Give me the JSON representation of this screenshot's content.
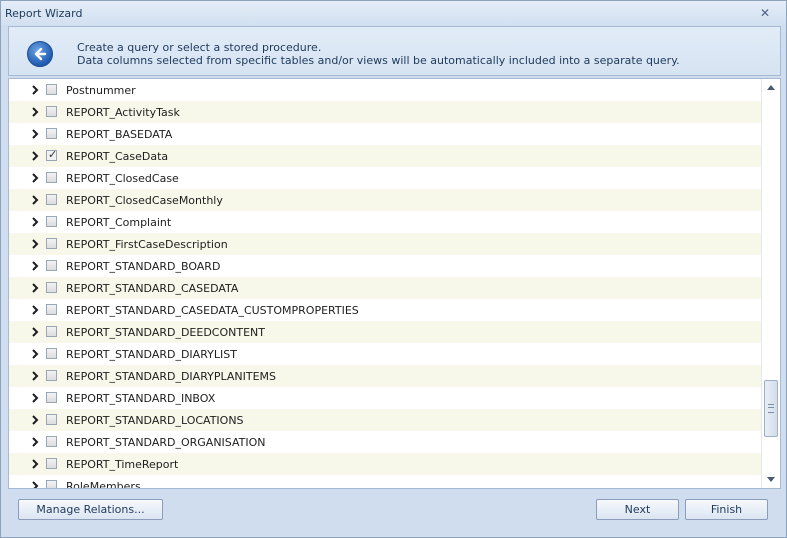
{
  "window": {
    "title": "Report Wizard"
  },
  "header": {
    "line1": "Create a query or select a stored procedure.",
    "line2": "Data columns selected from specific tables and/or views will be automatically included into a separate query."
  },
  "tables": [
    {
      "name": "Postnummer",
      "checked": false
    },
    {
      "name": "REPORT_ActivityTask",
      "checked": false
    },
    {
      "name": "REPORT_BASEDATA",
      "checked": false
    },
    {
      "name": "REPORT_CaseData",
      "checked": true
    },
    {
      "name": "REPORT_ClosedCase",
      "checked": false
    },
    {
      "name": "REPORT_ClosedCaseMonthly",
      "checked": false
    },
    {
      "name": "REPORT_Complaint",
      "checked": false
    },
    {
      "name": "REPORT_FirstCaseDescription",
      "checked": false
    },
    {
      "name": "REPORT_STANDARD_BOARD",
      "checked": false
    },
    {
      "name": "REPORT_STANDARD_CASEDATA",
      "checked": false
    },
    {
      "name": "REPORT_STANDARD_CASEDATA_CUSTOMPROPERTIES",
      "checked": false
    },
    {
      "name": "REPORT_STANDARD_DEEDCONTENT",
      "checked": false
    },
    {
      "name": "REPORT_STANDARD_DIARYLIST",
      "checked": false
    },
    {
      "name": "REPORT_STANDARD_DIARYPLANITEMS",
      "checked": false
    },
    {
      "name": "REPORT_STANDARD_INBOX",
      "checked": false
    },
    {
      "name": "REPORT_STANDARD_LOCATIONS",
      "checked": false
    },
    {
      "name": "REPORT_STANDARD_ORGANISATION",
      "checked": false
    },
    {
      "name": "REPORT_TimeReport",
      "checked": false
    },
    {
      "name": "RoleMembers",
      "checked": false
    }
  ],
  "buttons": {
    "manage_relations": "Manage Relations...",
    "next": "Next",
    "finish": "Finish"
  },
  "icons": {
    "back": "back-arrow-icon",
    "close": "close-icon",
    "expand": "chevron-right-icon"
  },
  "colors": {
    "window_bg": "#cfddee",
    "accent_blue": "#1f5bb0",
    "alt_row": "#f7f7ea"
  }
}
